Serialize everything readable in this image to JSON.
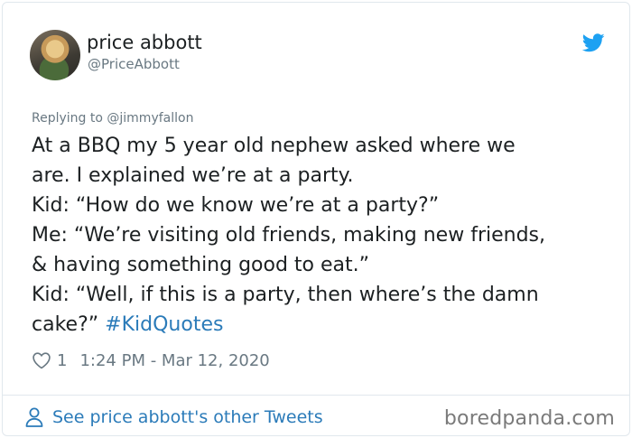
{
  "user": {
    "name": "price abbott",
    "handle": "@PriceAbbott"
  },
  "reply": {
    "prefix": "Replying to",
    "to": "@jimmyfallon"
  },
  "tweet": {
    "lines": [
      "At a BBQ my 5 year old nephew asked where we",
      "are. I explained we’re at a party.",
      "Kid: “How do we know we’re at a party?”",
      "Me: “We’re visiting old friends, making new friends,",
      "& having something good to eat.”",
      "Kid: “Well, if this is a party, then where’s the damn",
      "cake?”"
    ],
    "hashtag": "#KidQuotes"
  },
  "meta": {
    "likes": "1",
    "timestamp": "1:24 PM - Mar 12, 2020"
  },
  "footer": {
    "link_label": "See price abbott's other Tweets",
    "watermark": "boredpanda.com"
  },
  "colors": {
    "link": "#2b7bb9",
    "muted": "#697882",
    "twitter_blue": "#1da1f2"
  },
  "icons": [
    "twitter-bird-icon",
    "heart-icon",
    "person-icon"
  ]
}
